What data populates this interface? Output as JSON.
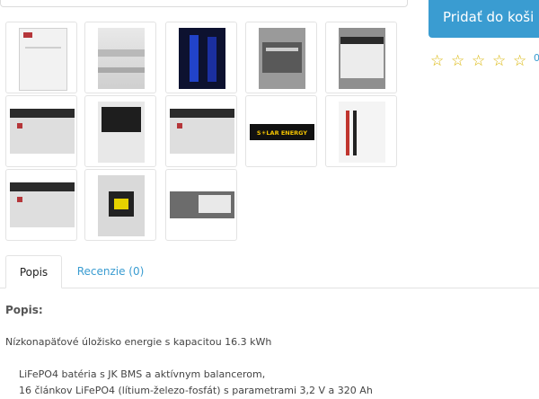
{
  "product": {
    "add_to_cart_label": "Pridať do koši",
    "rating_stars": 0,
    "rating_count": "0"
  },
  "gallery": {
    "logo_text": "S☀LAR ENERGY"
  },
  "tabs": {
    "description_label": "Popis",
    "reviews_label": "Recenzie (0)"
  },
  "description": {
    "heading": "Popis:",
    "intro": "Nízkonapäťové úložisko energie s kapacitou 16.3 kWh",
    "list": [
      "LiFePO4 batéria s JK BMS a aktívnym balancerom,",
      "16 článkov LiFePO4 (lítium-železo-fosfát) s parametrami 3,2 V a 320 Ah"
    ]
  }
}
